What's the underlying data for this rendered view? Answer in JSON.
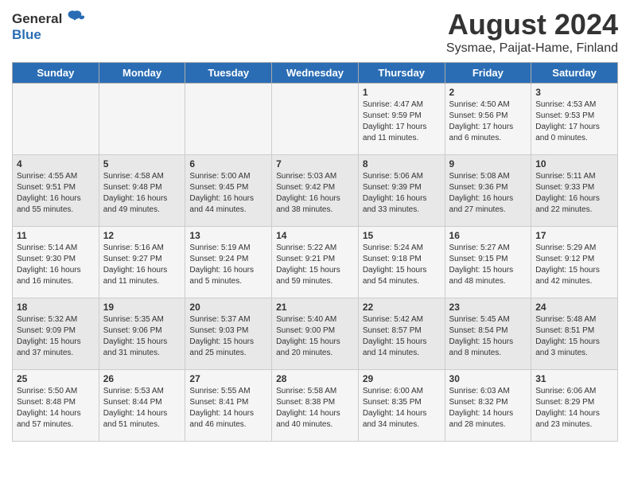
{
  "header": {
    "logo_general": "General",
    "logo_blue": "Blue",
    "month_year": "August 2024",
    "location": "Sysmae, Paijat-Hame, Finland"
  },
  "days_of_week": [
    "Sunday",
    "Monday",
    "Tuesday",
    "Wednesday",
    "Thursday",
    "Friday",
    "Saturday"
  ],
  "weeks": [
    [
      {
        "day": "",
        "info": ""
      },
      {
        "day": "",
        "info": ""
      },
      {
        "day": "",
        "info": ""
      },
      {
        "day": "",
        "info": ""
      },
      {
        "day": "1",
        "info": "Sunrise: 4:47 AM\nSunset: 9:59 PM\nDaylight: 17 hours\nand 11 minutes."
      },
      {
        "day": "2",
        "info": "Sunrise: 4:50 AM\nSunset: 9:56 PM\nDaylight: 17 hours\nand 6 minutes."
      },
      {
        "day": "3",
        "info": "Sunrise: 4:53 AM\nSunset: 9:53 PM\nDaylight: 17 hours\nand 0 minutes."
      }
    ],
    [
      {
        "day": "4",
        "info": "Sunrise: 4:55 AM\nSunset: 9:51 PM\nDaylight: 16 hours\nand 55 minutes."
      },
      {
        "day": "5",
        "info": "Sunrise: 4:58 AM\nSunset: 9:48 PM\nDaylight: 16 hours\nand 49 minutes."
      },
      {
        "day": "6",
        "info": "Sunrise: 5:00 AM\nSunset: 9:45 PM\nDaylight: 16 hours\nand 44 minutes."
      },
      {
        "day": "7",
        "info": "Sunrise: 5:03 AM\nSunset: 9:42 PM\nDaylight: 16 hours\nand 38 minutes."
      },
      {
        "day": "8",
        "info": "Sunrise: 5:06 AM\nSunset: 9:39 PM\nDaylight: 16 hours\nand 33 minutes."
      },
      {
        "day": "9",
        "info": "Sunrise: 5:08 AM\nSunset: 9:36 PM\nDaylight: 16 hours\nand 27 minutes."
      },
      {
        "day": "10",
        "info": "Sunrise: 5:11 AM\nSunset: 9:33 PM\nDaylight: 16 hours\nand 22 minutes."
      }
    ],
    [
      {
        "day": "11",
        "info": "Sunrise: 5:14 AM\nSunset: 9:30 PM\nDaylight: 16 hours\nand 16 minutes."
      },
      {
        "day": "12",
        "info": "Sunrise: 5:16 AM\nSunset: 9:27 PM\nDaylight: 16 hours\nand 11 minutes."
      },
      {
        "day": "13",
        "info": "Sunrise: 5:19 AM\nSunset: 9:24 PM\nDaylight: 16 hours\nand 5 minutes."
      },
      {
        "day": "14",
        "info": "Sunrise: 5:22 AM\nSunset: 9:21 PM\nDaylight: 15 hours\nand 59 minutes."
      },
      {
        "day": "15",
        "info": "Sunrise: 5:24 AM\nSunset: 9:18 PM\nDaylight: 15 hours\nand 54 minutes."
      },
      {
        "day": "16",
        "info": "Sunrise: 5:27 AM\nSunset: 9:15 PM\nDaylight: 15 hours\nand 48 minutes."
      },
      {
        "day": "17",
        "info": "Sunrise: 5:29 AM\nSunset: 9:12 PM\nDaylight: 15 hours\nand 42 minutes."
      }
    ],
    [
      {
        "day": "18",
        "info": "Sunrise: 5:32 AM\nSunset: 9:09 PM\nDaylight: 15 hours\nand 37 minutes."
      },
      {
        "day": "19",
        "info": "Sunrise: 5:35 AM\nSunset: 9:06 PM\nDaylight: 15 hours\nand 31 minutes."
      },
      {
        "day": "20",
        "info": "Sunrise: 5:37 AM\nSunset: 9:03 PM\nDaylight: 15 hours\nand 25 minutes."
      },
      {
        "day": "21",
        "info": "Sunrise: 5:40 AM\nSunset: 9:00 PM\nDaylight: 15 hours\nand 20 minutes."
      },
      {
        "day": "22",
        "info": "Sunrise: 5:42 AM\nSunset: 8:57 PM\nDaylight: 15 hours\nand 14 minutes."
      },
      {
        "day": "23",
        "info": "Sunrise: 5:45 AM\nSunset: 8:54 PM\nDaylight: 15 hours\nand 8 minutes."
      },
      {
        "day": "24",
        "info": "Sunrise: 5:48 AM\nSunset: 8:51 PM\nDaylight: 15 hours\nand 3 minutes."
      }
    ],
    [
      {
        "day": "25",
        "info": "Sunrise: 5:50 AM\nSunset: 8:48 PM\nDaylight: 14 hours\nand 57 minutes."
      },
      {
        "day": "26",
        "info": "Sunrise: 5:53 AM\nSunset: 8:44 PM\nDaylight: 14 hours\nand 51 minutes."
      },
      {
        "day": "27",
        "info": "Sunrise: 5:55 AM\nSunset: 8:41 PM\nDaylight: 14 hours\nand 46 minutes."
      },
      {
        "day": "28",
        "info": "Sunrise: 5:58 AM\nSunset: 8:38 PM\nDaylight: 14 hours\nand 40 minutes."
      },
      {
        "day": "29",
        "info": "Sunrise: 6:00 AM\nSunset: 8:35 PM\nDaylight: 14 hours\nand 34 minutes."
      },
      {
        "day": "30",
        "info": "Sunrise: 6:03 AM\nSunset: 8:32 PM\nDaylight: 14 hours\nand 28 minutes."
      },
      {
        "day": "31",
        "info": "Sunrise: 6:06 AM\nSunset: 8:29 PM\nDaylight: 14 hours\nand 23 minutes."
      }
    ]
  ]
}
